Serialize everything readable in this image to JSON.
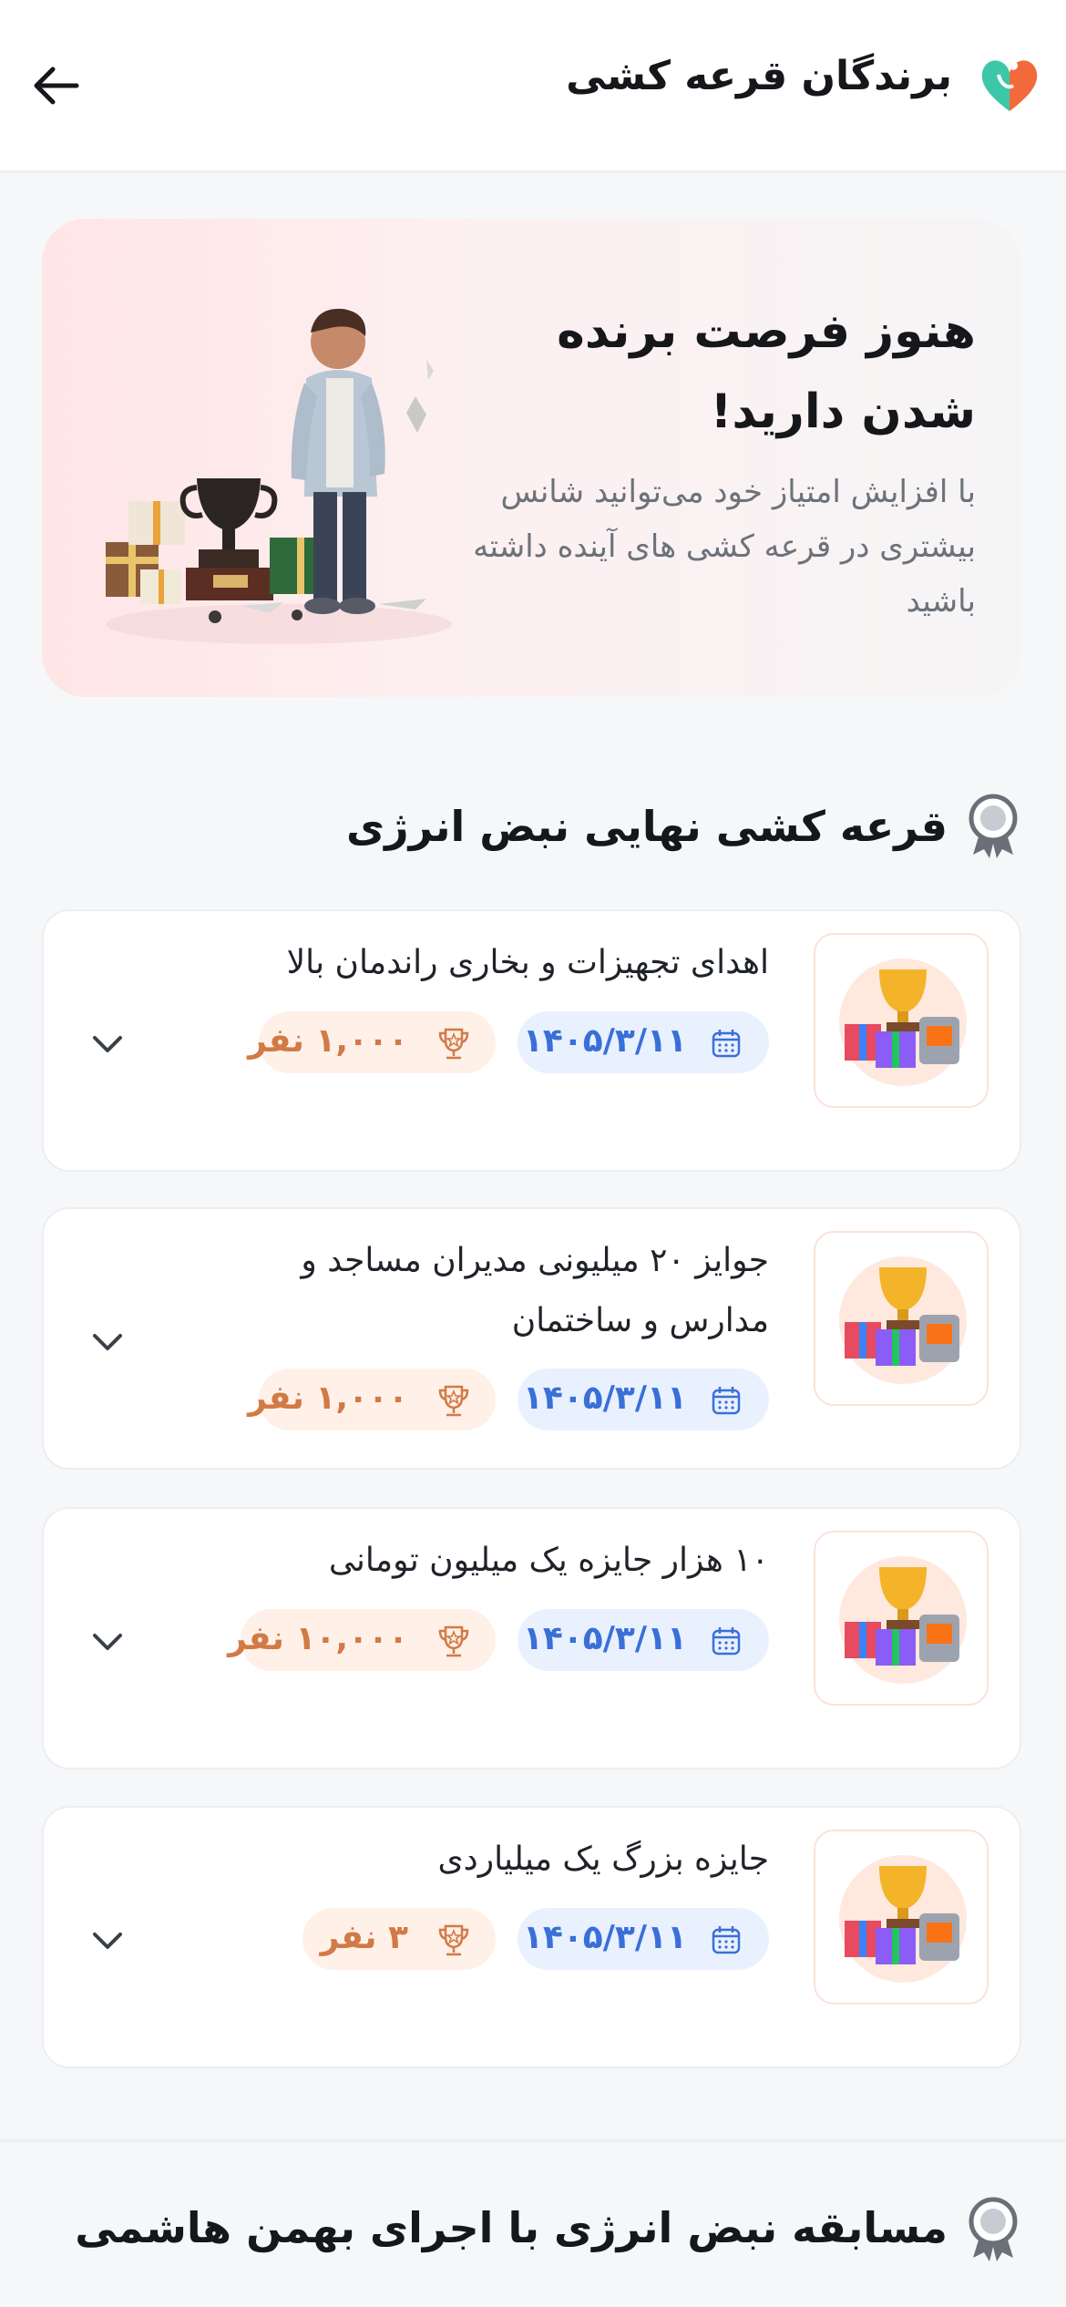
{
  "header": {
    "title": "برندگان قرعه کشی"
  },
  "banner": {
    "title": "هنوز فرصت برنده شدن دارید!",
    "text": "با افزایش امتیاز خود می‌توانید شانس بیشتری در قرعه کشی های آینده داشته باشید"
  },
  "sections": [
    {
      "title": "قرعه کشی نهایی نبض انرژی",
      "items": [
        {
          "title": "اهدای تجهیزات و بخاری راندمان بالا",
          "date": "۱۴۰۵/۳/۱۱",
          "count": "۱,۰۰۰ نفر"
        },
        {
          "title": "جوایز ۲۰ میلیونی مدیران مساجد و مدارس و ساختمان",
          "date": "۱۴۰۵/۳/۱۱",
          "count": "۱,۰۰۰ نفر"
        },
        {
          "title": "۱۰ هزار جایزه یک میلیون تومانی",
          "date": "۱۴۰۵/۳/۱۱",
          "count": "۱۰,۰۰۰ نفر"
        },
        {
          "title": "جایزه بزرگ یک میلیاردی",
          "date": "۱۴۰۵/۳/۱۱",
          "count": "۳ نفر"
        }
      ]
    },
    {
      "title": "مسابقه نبض انرژی با اجرای بهمن هاشمی"
    }
  ],
  "colors": {
    "date_badge_bg": "#e9f1ff",
    "date_text": "#3a6fd8",
    "count_badge_bg": "#fff0e8",
    "count_text": "#d27a45"
  }
}
